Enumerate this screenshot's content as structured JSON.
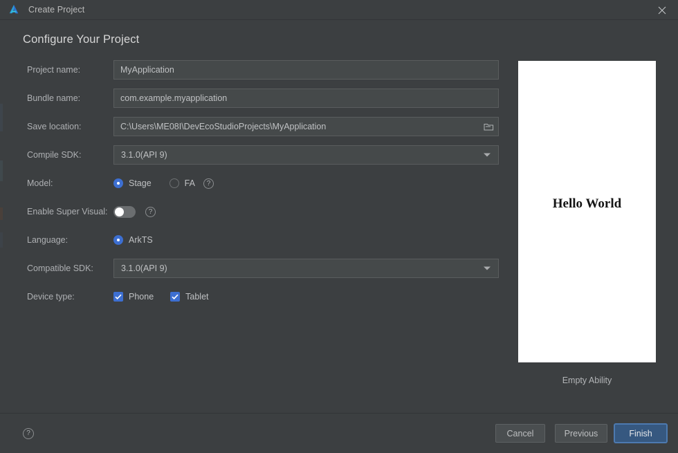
{
  "window": {
    "title": "Create Project",
    "logo_icon": "deveco-studio-logo",
    "close_icon": "close-icon"
  },
  "page": {
    "heading": "Configure Your Project"
  },
  "form": {
    "project_name": {
      "label": "Project name:",
      "value": "MyApplication",
      "placeholder": ""
    },
    "bundle_name": {
      "label": "Bundle name:",
      "value": "com.example.myapplication",
      "placeholder": ""
    },
    "save_location": {
      "label": "Save location:",
      "value": "C:\\Users\\ME08I\\DevEcoStudioProjects\\MyApplication",
      "placeholder": "",
      "browse_icon": "folder-icon"
    },
    "compile_sdk": {
      "label": "Compile SDK:",
      "value": "3.1.0(API 9)",
      "options": [
        "3.1.0(API 9)"
      ],
      "arrow_icon": "chevron-down-icon"
    },
    "model": {
      "label": "Model:",
      "options": [
        {
          "label": "Stage",
          "checked": true
        },
        {
          "label": "FA",
          "checked": false
        }
      ],
      "help_icon": "question-mark-icon",
      "help_glyph": "?"
    },
    "enable_super_visual": {
      "label": "Enable Super Visual:",
      "state": "off",
      "help_icon": "question-mark-icon",
      "help_glyph": "?"
    },
    "language": {
      "label": "Language:",
      "options": [
        {
          "label": "ArkTS",
          "checked": true
        }
      ]
    },
    "compatible_sdk": {
      "label": "Compatible SDK:",
      "value": "3.1.0(API 9)",
      "options": [
        "3.1.0(API 9)"
      ],
      "arrow_icon": "chevron-down-icon"
    },
    "device_type": {
      "label": "Device type:",
      "options": [
        {
          "label": "Phone",
          "checked": true
        },
        {
          "label": "Tablet",
          "checked": true
        }
      ]
    }
  },
  "preview": {
    "screen_text": "Hello World",
    "caption": "Empty Ability"
  },
  "footer": {
    "help_glyph": "?",
    "help_icon": "question-mark-icon",
    "cancel_label": "Cancel",
    "previous_label": "Previous",
    "finish_label": "Finish"
  },
  "colors": {
    "accent_blue": "#3d6fd1",
    "finish_button": "#365880",
    "finish_border": "#4d7ab0",
    "background": "#3c3f41",
    "field_background": "#45494a",
    "text_primary": "#c0c2c4",
    "text_label": "#aeb0b3"
  }
}
